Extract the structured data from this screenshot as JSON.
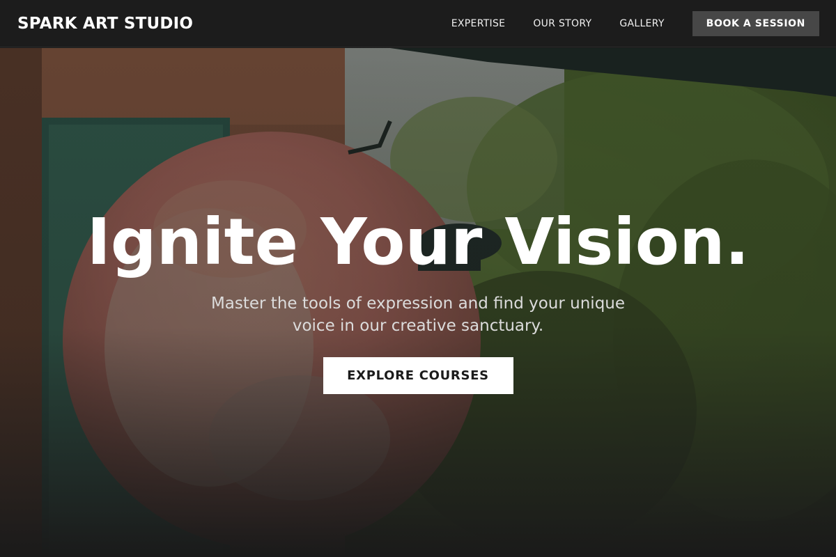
{
  "header": {
    "brand": "SPARK ART STUDIO",
    "nav": [
      {
        "label": "EXPERTISE"
      },
      {
        "label": "OUR STORY"
      },
      {
        "label": "GALLERY"
      }
    ],
    "cta_label": "BOOK A SESSION"
  },
  "hero": {
    "headline": "Ignite Your Vision.",
    "subheadline": "Master the tools of expression and find your unique voice in our creative sanctuary.",
    "cta_label": "EXPLORE COURSES"
  },
  "colors": {
    "header_bg": "#1c1c1c",
    "book_button_bg": "#474747",
    "cta_bg": "#ffffff",
    "cta_text": "#1b1b1b"
  }
}
